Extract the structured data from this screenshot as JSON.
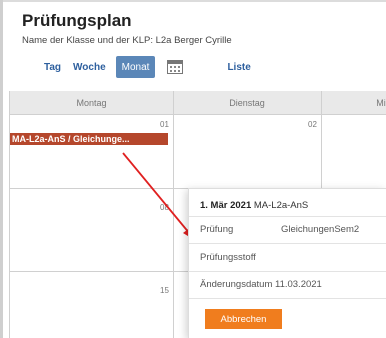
{
  "page": {
    "title": "Prüfungsplan",
    "subtitle": "Name der Klasse und der KLP: L2a Berger Cyrille"
  },
  "toolbar": {
    "day_label": "Tag",
    "week_label": "Woche",
    "month_label": "Monat",
    "list_label": "Liste"
  },
  "calendar": {
    "weekdays": [
      "Montag",
      "Dienstag",
      "Mi"
    ],
    "day_numbers": [
      "01",
      "02",
      "08",
      "15"
    ],
    "event_label": "MA-L2a-AnS / Gleichunge..."
  },
  "popup": {
    "date": "1. Mär 2021",
    "course": "MA-L2a-AnS",
    "exam_label": "Prüfung",
    "exam_value": "GleichungenSem2",
    "material_label": "Prüfungsstoff",
    "change_date": "Änderungsdatum 11.03.2021",
    "cancel_label": "Abbrechen"
  },
  "colors": {
    "accent_blue": "#5b87b8",
    "link_blue": "#2d5f9e",
    "event_bg": "#b5472c",
    "button_orange": "#f07d1e",
    "arrow_red": "#e02020"
  }
}
